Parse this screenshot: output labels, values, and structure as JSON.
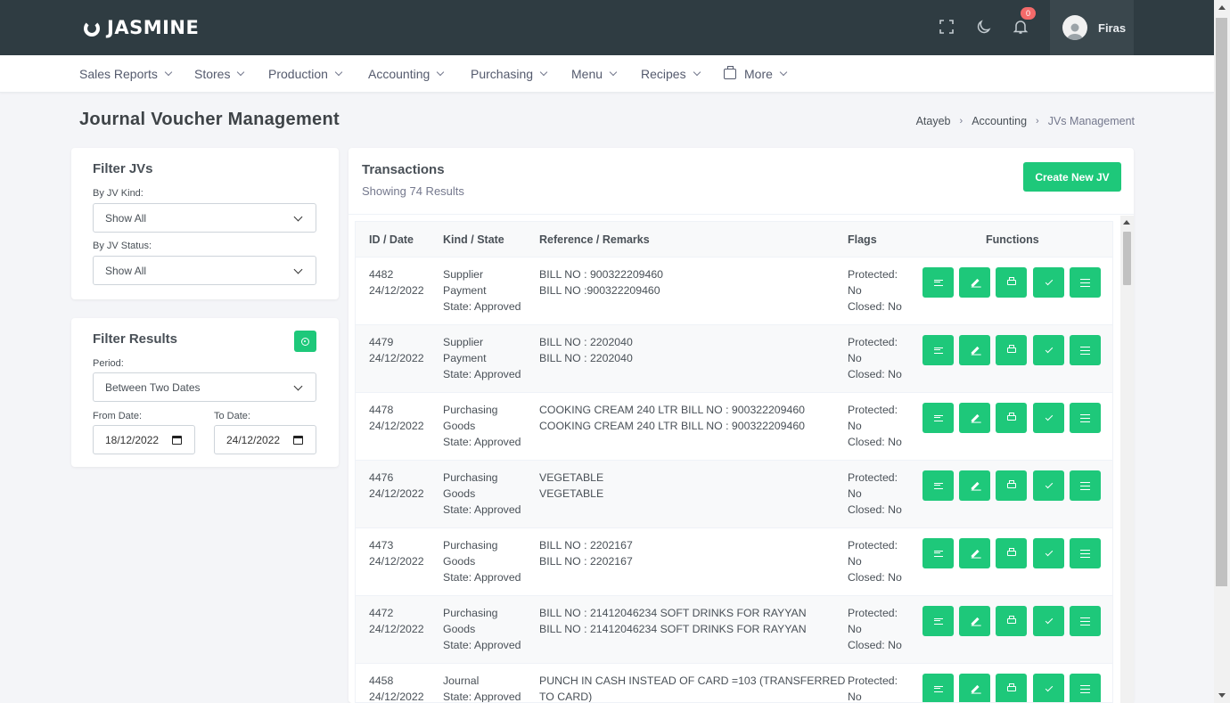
{
  "brand": "JASMINE",
  "topbar": {
    "notification_count": "0",
    "user_name": "Firas"
  },
  "nav": [
    {
      "label": "Sales Reports"
    },
    {
      "label": "Stores"
    },
    {
      "label": "Production"
    },
    {
      "label": "Accounting"
    },
    {
      "label": "Purchasing"
    },
    {
      "label": "Menu"
    },
    {
      "label": "Recipes"
    },
    {
      "label": "More"
    }
  ],
  "page": {
    "title": "Journal Voucher Management",
    "breadcrumb": [
      "Atayeb",
      "Accounting",
      "JVs Management"
    ]
  },
  "filter_jvs": {
    "title": "Filter JVs",
    "kind_label": "By JV Kind:",
    "kind_value": "Show All",
    "status_label": "By JV Status:",
    "status_value": "Show All"
  },
  "filter_results": {
    "title": "Filter Results",
    "period_label": "Period:",
    "period_value": "Between Two Dates",
    "from_label": "From Date:",
    "from_value": "18/12/2022",
    "to_label": "To Date:",
    "to_value": "24/12/2022"
  },
  "transactions": {
    "title": "Transactions",
    "subtitle": "Showing 74 Results",
    "create_label": "Create New JV",
    "columns": [
      "ID / Date",
      "Kind / State",
      "Reference / Remarks",
      "Flags",
      "Functions"
    ],
    "rows": [
      {
        "id": "4482",
        "date": "24/12/2022",
        "kind1": "Supplier",
        "kind2": "Payment",
        "state": "State: Approved",
        "ref1": "BILL NO : 900322209460",
        "ref2": "BILL NO :900322209460",
        "flag1": "Protected:",
        "flag2": "No",
        "flag3": "Closed: No"
      },
      {
        "id": "4479",
        "date": "24/12/2022",
        "kind1": "Supplier",
        "kind2": "Payment",
        "state": "State: Approved",
        "ref1": "BILL NO : 2202040",
        "ref2": "BILL NO : 2202040",
        "flag1": "Protected:",
        "flag2": "No",
        "flag3": "Closed: No"
      },
      {
        "id": "4478",
        "date": "24/12/2022",
        "kind1": "Purchasing",
        "kind2": "Goods",
        "state": "State: Approved",
        "ref1": "COOKING CREAM 240 LTR BILL NO : 900322209460",
        "ref2": "COOKING CREAM 240 LTR BILL NO : 900322209460",
        "flag1": "Protected:",
        "flag2": "No",
        "flag3": "Closed: No"
      },
      {
        "id": "4476",
        "date": "24/12/2022",
        "kind1": "Purchasing",
        "kind2": "Goods",
        "state": "State: Approved",
        "ref1": "VEGETABLE",
        "ref2": "VEGETABLE",
        "flag1": "Protected:",
        "flag2": "No",
        "flag3": "Closed: No"
      },
      {
        "id": "4473",
        "date": "24/12/2022",
        "kind1": "Purchasing",
        "kind2": "Goods",
        "state": "State: Approved",
        "ref1": "BILL NO : 2202167",
        "ref2": "BILL NO : 2202167",
        "flag1": "Protected:",
        "flag2": "No",
        "flag3": "Closed: No"
      },
      {
        "id": "4472",
        "date": "24/12/2022",
        "kind1": "Purchasing",
        "kind2": "Goods",
        "state": "State: Approved",
        "ref1": "BILL NO : 21412046234 SOFT DRINKS FOR RAYYAN",
        "ref2": "BILL NO : 21412046234 SOFT DRINKS FOR RAYYAN",
        "flag1": "Protected:",
        "flag2": "No",
        "flag3": "Closed: No"
      },
      {
        "id": "4458",
        "date": "24/12/2022",
        "kind1": "Journal",
        "kind2": "State: Approved",
        "state": "",
        "ref1": "PUNCH IN CASH INSTEAD OF CARD =103 (TRANSFERRED",
        "ref2": "TO CARD)",
        "flag1": "Protected:",
        "flag2": "No",
        "flag3": ""
      }
    ]
  },
  "colors": {
    "topbar": "#2f3c42",
    "accent": "#1ec87a",
    "badge": "#f46a6a"
  }
}
